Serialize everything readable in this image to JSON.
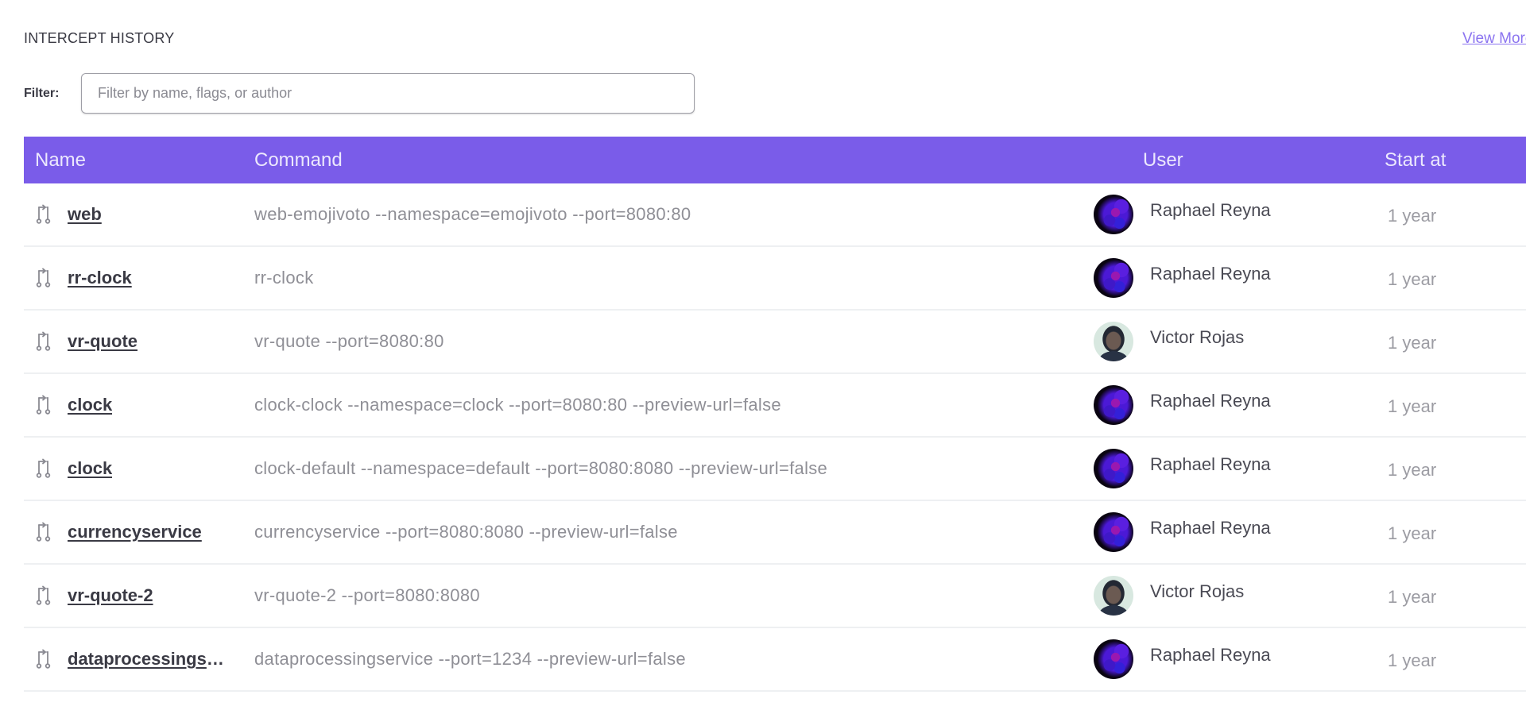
{
  "section": {
    "title": "INTERCEPT HISTORY",
    "view_more_label": "View More"
  },
  "filter": {
    "label": "Filter:",
    "value": "",
    "placeholder": "Filter by name, flags, or author"
  },
  "table": {
    "header_color": "#7a5ce9",
    "columns": [
      "Name",
      "Command",
      "User",
      "Start at"
    ],
    "rows": [
      {
        "icon": "intercept-icon",
        "name": "web",
        "command": "web-emojivoto --namespace=emojivoto --port=8080:80",
        "user": "Raphael Reyna",
        "avatar": "raphael",
        "start": "1 year"
      },
      {
        "icon": "intercept-icon",
        "name": "rr-clock",
        "command": "rr-clock",
        "user": "Raphael Reyna",
        "avatar": "raphael",
        "start": "1 year"
      },
      {
        "icon": "intercept-icon",
        "name": "vr-quote",
        "command": "vr-quote --port=8080:80",
        "user": "Victor Rojas",
        "avatar": "victor",
        "start": "1 year"
      },
      {
        "icon": "intercept-icon",
        "name": "clock",
        "command": "clock-clock --namespace=clock --port=8080:80 --preview-url=false",
        "user": "Raphael Reyna",
        "avatar": "raphael",
        "start": "1 year"
      },
      {
        "icon": "intercept-icon",
        "name": "clock",
        "command": "clock-default --namespace=default --port=8080:8080 --preview-url=false",
        "user": "Raphael Reyna",
        "avatar": "raphael",
        "start": "1 year"
      },
      {
        "icon": "intercept-icon",
        "name": "currencyservice",
        "command": "currencyservice --port=8080:8080 --preview-url=false",
        "user": "Raphael Reyna",
        "avatar": "raphael",
        "start": "1 year"
      },
      {
        "icon": "intercept-icon",
        "name": "vr-quote-2",
        "command": "vr-quote-2 --port=8080:8080",
        "user": "Victor Rojas",
        "avatar": "victor",
        "start": "1 year"
      },
      {
        "icon": "intercept-icon",
        "name": "dataprocessingservice",
        "command": "dataprocessingservice --port=1234 --preview-url=false",
        "user": "Raphael Reyna",
        "avatar": "raphael",
        "start": "1 year"
      }
    ]
  }
}
